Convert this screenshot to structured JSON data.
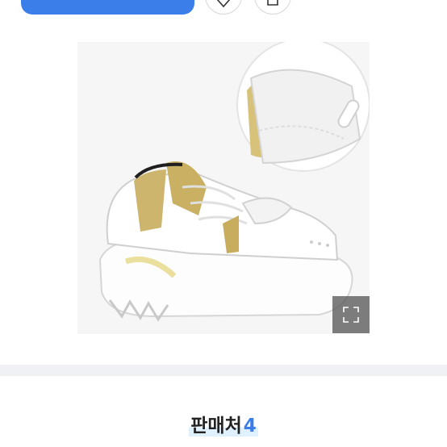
{
  "top_bar": {
    "buy_label": "",
    "wish_icon": "heart-icon",
    "share_icon": "share-icon"
  },
  "product": {
    "expand_icon": "expand-icon"
  },
  "sellers": {
    "title": "판매처",
    "count": "4"
  },
  "colors": {
    "accent": "#3b7de9",
    "divider": "#eff1f4"
  }
}
